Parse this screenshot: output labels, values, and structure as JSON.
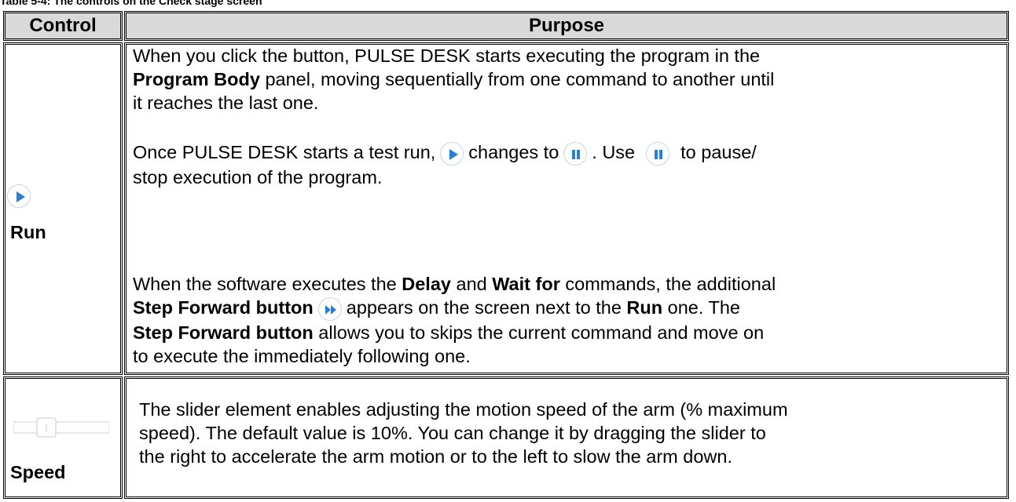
{
  "caption": "Table 5-4: The controls on the Check stage screen",
  "headers": {
    "control": "Control",
    "purpose": "Purpose"
  },
  "run": {
    "label": "Run",
    "p1_a": "When you click the button, PULSE DESK starts executing the program in the",
    "p1_bold": "Program Body",
    "p1_b": "panel, moving sequentially from one command to another until",
    "p1_c": "it reaches the last one.",
    "p2_a": "Once PULSE DESK starts a test run,",
    "p2_b": "changes to",
    "p2_c": ". Use",
    "p2_d": "to pause/",
    "p2_e": "stop execution of the program.",
    "p3_a": "When the software executes the",
    "p3_delay": "Delay",
    "p3_and": "and",
    "p3_waitfor": "Wait for",
    "p3_b": "commands, the additional",
    "p3_stepfwd1": "Step Forward button",
    "p3_c": "appears on the screen next to the",
    "p3_run": "Run",
    "p3_d": "one. The",
    "p3_stepfwd2": "Step Forward button",
    "p3_e": "allows you to skips the current command and move on",
    "p3_f": "to execute the immediately following one."
  },
  "speed": {
    "label": "Speed",
    "line1": "The slider element enables adjusting the motion speed of the arm (% maximum",
    "line2": "speed). The default value is 10%. You can change it by dragging the slider to",
    "line3": "the right to accelerate the arm motion or to the left to slow the arm down."
  },
  "icons": {
    "play": "play-icon",
    "pause": "pause-icon",
    "step_forward": "step-forward-icon",
    "slider": "speed-slider-icon"
  },
  "colors": {
    "icon_blue": "#2b7fd1",
    "header_bg": "#d9d9d9",
    "slider_track": "#d0d0d0"
  }
}
